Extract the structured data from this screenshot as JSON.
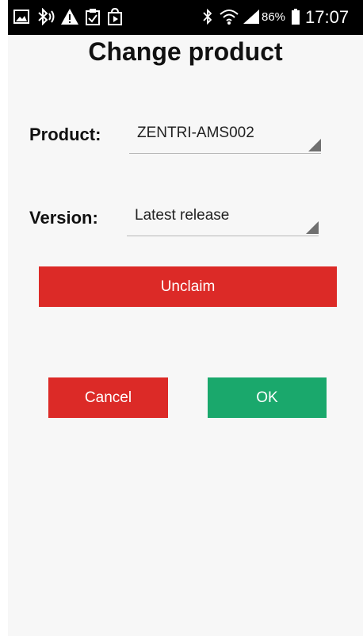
{
  "status_bar": {
    "icons": [
      "image-icon",
      "bluetooth-audio-icon",
      "warning-icon",
      "clipboard-check-icon",
      "store-icon",
      "bluetooth-icon",
      "wifi-icon",
      "signal-icon",
      "battery-icon"
    ],
    "battery_percent": "86%",
    "time": "17:07"
  },
  "page": {
    "title": "Change product"
  },
  "form": {
    "product_label": "Product:",
    "product_value": "ZENTRI-AMS002",
    "version_label": "Version:",
    "version_value": "Latest release"
  },
  "buttons": {
    "unclaim": "Unclaim",
    "cancel": "Cancel",
    "ok": "OK"
  },
  "colors": {
    "danger": "#dc2a27",
    "success": "#1aa86c",
    "background": "#f7f7f7",
    "status_bar": "#000000"
  }
}
